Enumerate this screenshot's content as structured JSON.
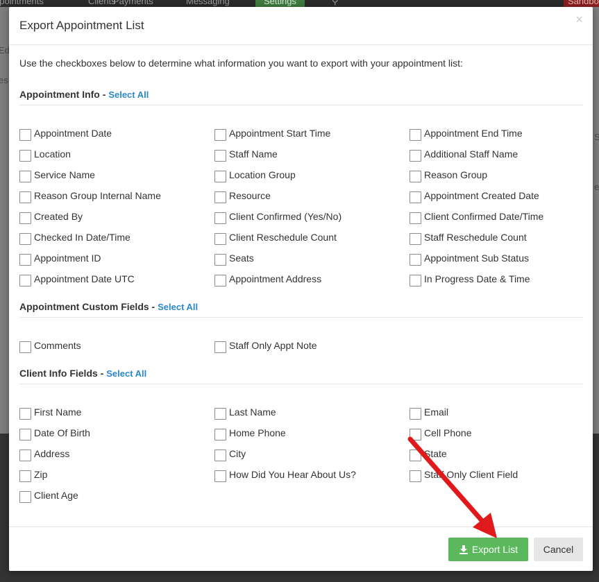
{
  "app": {
    "nav": [
      "ppointments",
      "Clients",
      "Payments",
      "Messaging",
      "Settings"
    ],
    "sandbox": "Sandbo",
    "bg_fragments": [
      "Ed",
      "es",
      "S",
      "ec"
    ]
  },
  "modal": {
    "title": "Export Appointment List",
    "close": "×",
    "intro": "Use the checkboxes below to determine what information you want to export with your appointment list:",
    "select_all": "Select All",
    "sections": [
      {
        "title": "Appointment Info -",
        "options": [
          "Appointment Date",
          "Appointment Start Time",
          "Appointment End Time",
          "Location",
          "Staff Name",
          "Additional Staff Name",
          "Service Name",
          "Location Group",
          "Reason Group",
          "Reason Group Internal Name",
          "Resource",
          "Appointment Created Date",
          "Created By",
          "Client Confirmed (Yes/No)",
          "Client Confirmed Date/Time",
          "Checked In Date/Time",
          "Client Reschedule Count",
          "Staff Reschedule Count",
          "Appointment ID",
          "Seats",
          "Appointment Sub Status",
          "Appointment Date UTC",
          "Appointment Address",
          "In Progress Date & Time"
        ]
      },
      {
        "title": "Appointment Custom Fields -",
        "options": [
          "Comments",
          "Staff Only Appt Note"
        ]
      },
      {
        "title": "Client Info Fields -",
        "options": [
          "First Name",
          "Last Name",
          "Email",
          "Date Of Birth",
          "Home Phone",
          "Cell Phone",
          "Address",
          "City",
          "State",
          "Zip",
          "How Did You Hear About Us?",
          "Staff Only Client Field",
          "Client Age"
        ]
      }
    ],
    "export_label": "Export List",
    "cancel_label": "Cancel"
  },
  "colors": {
    "export_green": "#5cb85c",
    "link_blue": "#2b87c7",
    "arrow_red": "#e0191b"
  }
}
